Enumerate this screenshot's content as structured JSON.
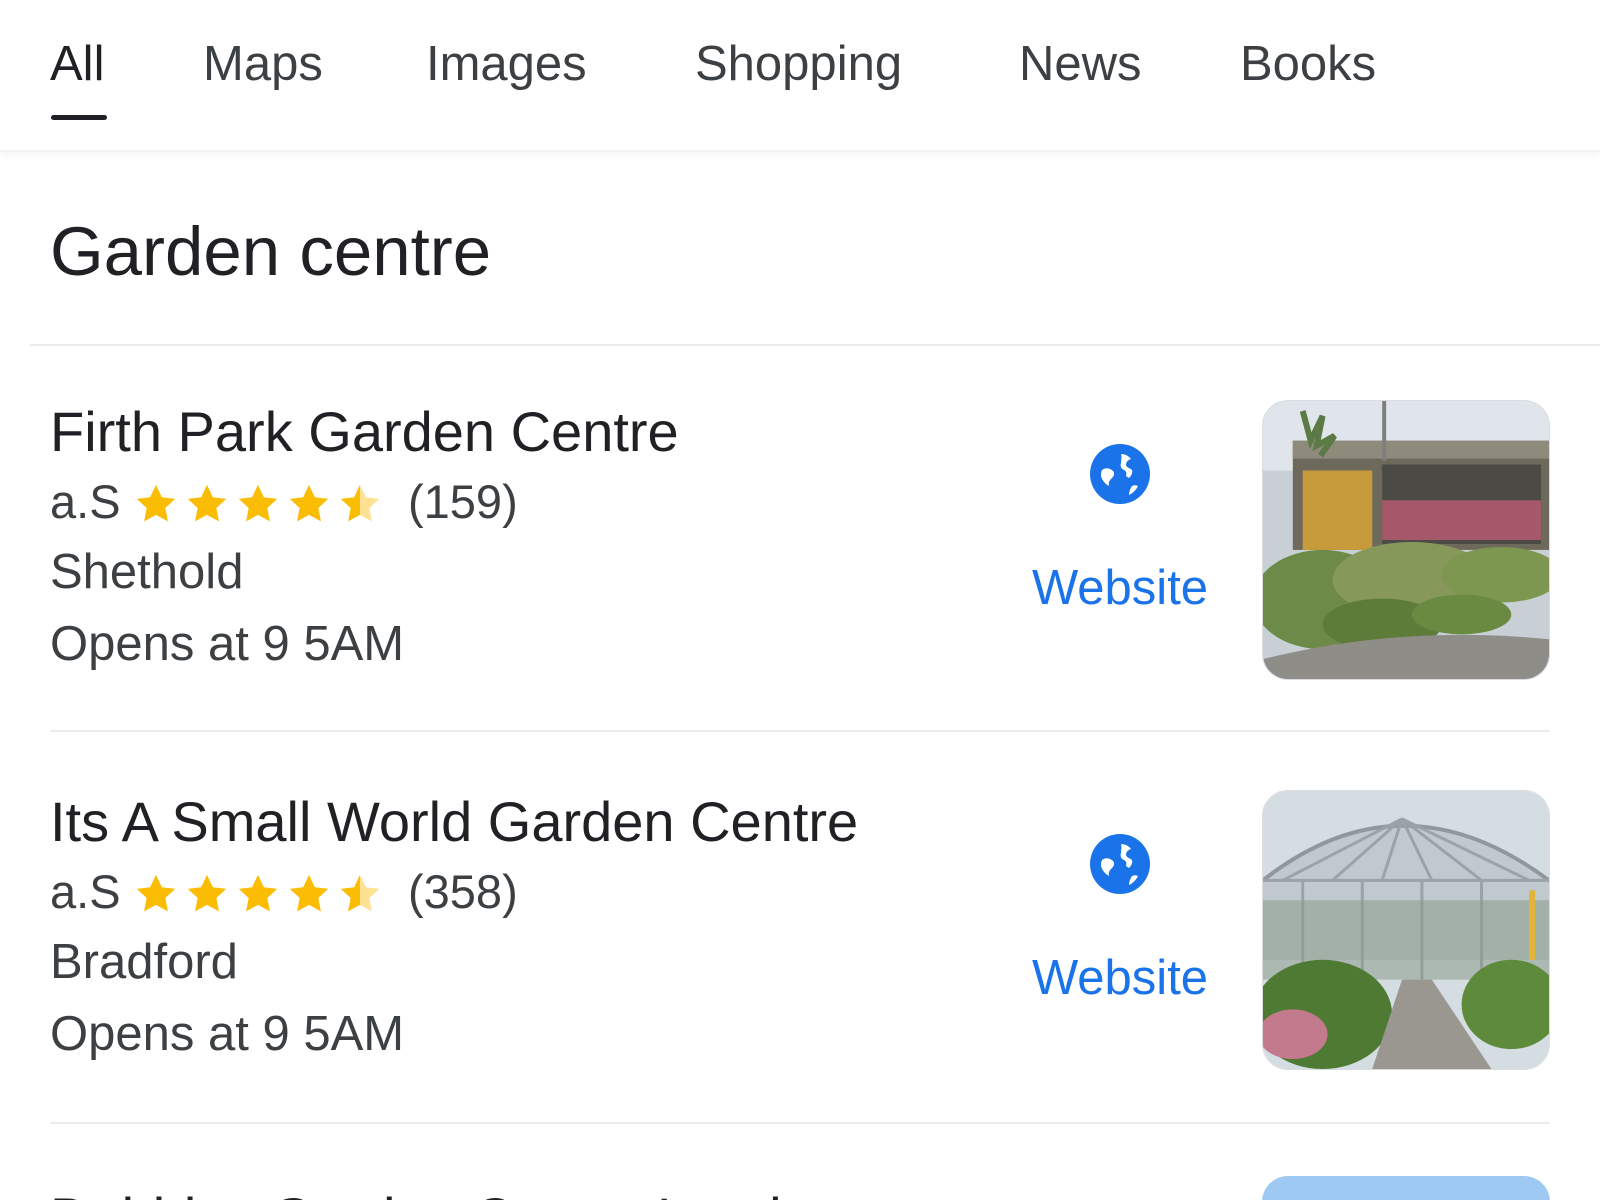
{
  "tabs": [
    {
      "label": "All",
      "active": true
    },
    {
      "label": "Maps",
      "active": false
    },
    {
      "label": "Images",
      "active": false
    },
    {
      "label": "Shopping",
      "active": false
    },
    {
      "label": "News",
      "active": false
    },
    {
      "label": "Books",
      "active": false
    }
  ],
  "section_title": "Garden centre",
  "results": [
    {
      "name": "Firth Park Garden Centre",
      "rating": "a.S",
      "stars": 4.5,
      "reviews": "(159)",
      "location": "Shethold",
      "hours": "Opens at 9 5AM",
      "website_label": "Website",
      "website_icon": "globe-icon"
    },
    {
      "name": "Its A Small World Garden Centre",
      "rating": "a.S",
      "stars": 4.5,
      "reviews": "(358)",
      "location": "Bradford",
      "hours": "Opens at 9 5AM",
      "website_label": "Website",
      "website_icon": "globe-icon"
    }
  ],
  "partial_result_name": "Dobbies Garden Centre Leeds",
  "colors": {
    "accent_blue": "#1a73e8",
    "star_yellow": "#fbbc04",
    "text_primary": "#202124",
    "text_secondary": "#3c4043"
  }
}
